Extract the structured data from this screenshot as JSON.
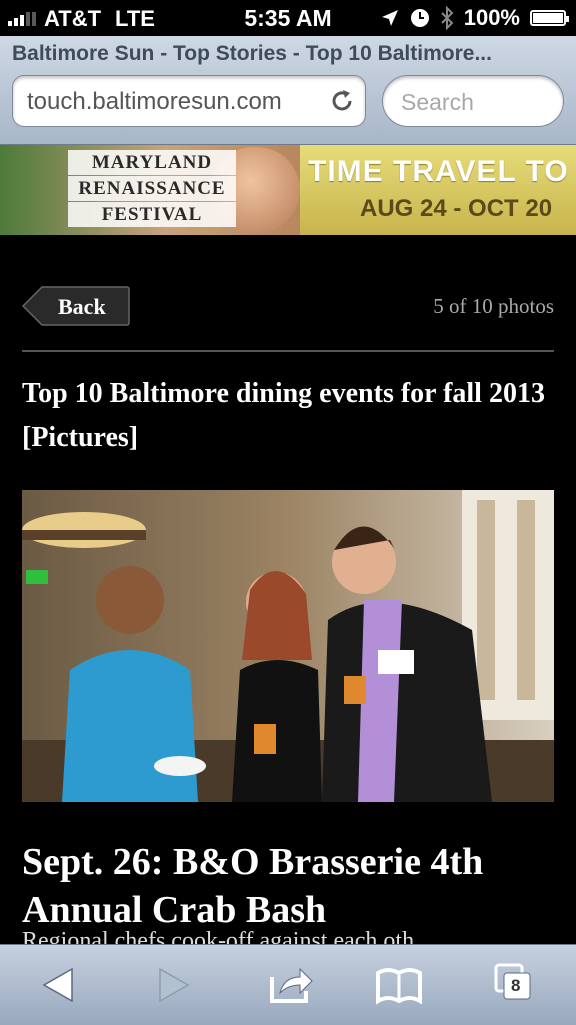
{
  "status_bar": {
    "carrier": "AT&T",
    "network": "LTE",
    "time": "5:35 AM",
    "battery": "100%",
    "battery_level": 1.0
  },
  "browser": {
    "page_title": "Baltimore Sun - Top Stories - Top 10 Baltimore...",
    "url": "touch.baltimoresun.com",
    "search_placeholder": "Search"
  },
  "ad": {
    "festival_lines": [
      "MARYLAND",
      "RENAISSANCE",
      "FESTIVAL"
    ],
    "tagline": "TIME TRAVEL TO FUN!",
    "dates": "AUG 24 - OCT 20"
  },
  "gallery": {
    "back_label": "Back",
    "photo_count": "5 of 10 photos",
    "headline": "Top 10 Baltimore dining events for fall 2013 [Pictures]",
    "caption_title": "Sept. 26: B&O Brasserie 4th Annual Crab Bash",
    "caption_body": "Regional chefs cook-off against each oth"
  },
  "toolbar": {
    "tab_count": "8"
  },
  "icons": [
    "signal-icon",
    "location-arrow-icon",
    "clock-icon",
    "bluetooth-icon",
    "battery-icon",
    "reload-icon",
    "back-arrow-icon",
    "forward-arrow-icon",
    "share-icon",
    "bookmarks-icon",
    "tabs-icon"
  ]
}
